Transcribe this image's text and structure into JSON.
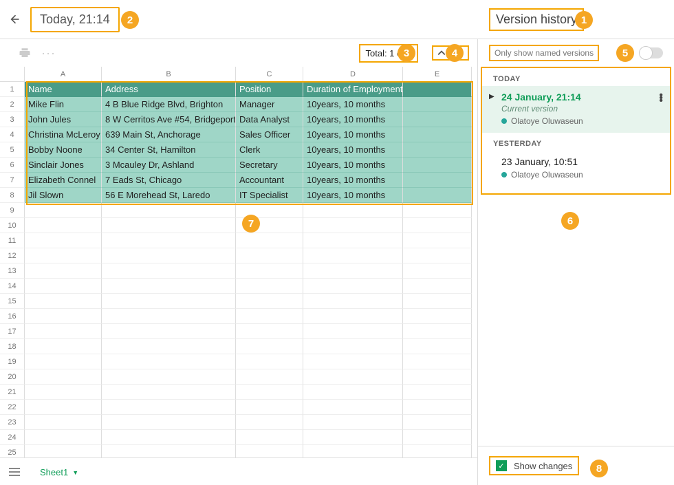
{
  "header": {
    "title": "Today, 21:14"
  },
  "toolbar": {
    "total": "Total: 1 edit"
  },
  "sidebar": {
    "title": "Version history",
    "only_named": "Only show named versions",
    "sections": [
      {
        "label": "TODAY",
        "items": [
          {
            "title": "24 January, 21:14",
            "sub": "Current version",
            "author": "Olatoye Oluwaseun",
            "selected": true
          }
        ]
      },
      {
        "label": "YESTERDAY",
        "items": [
          {
            "title": "23 January, 10:51",
            "author": "Olatoye Oluwaseun",
            "selected": false
          }
        ]
      }
    ],
    "show_changes": "Show changes"
  },
  "sheet": {
    "tab": "Sheet1"
  },
  "columns": [
    "A",
    "B",
    "C",
    "D",
    "E"
  ],
  "chart_data": {
    "type": "table",
    "headers": [
      "Name",
      "Address",
      "Position",
      "Duration of Employment"
    ],
    "rows": [
      [
        "Mike Flin",
        "4 B Blue Ridge Blvd, Brighton",
        "Manager",
        "10years, 10 months"
      ],
      [
        "John Jules",
        "8 W Cerritos Ave #54, Bridgeport",
        "Data Analyst",
        "10years, 10 months"
      ],
      [
        "Christina McLeroy",
        "639 Main St, Anchorage",
        "Sales Officer",
        "10years, 10 months"
      ],
      [
        "Bobby Noone",
        "34 Center St, Hamilton",
        "Clerk",
        "10years, 10 months"
      ],
      [
        "Sinclair Jones",
        "3 Mcauley Dr, Ashland",
        "Secretary",
        "10years, 10 months"
      ],
      [
        "Elizabeth Connel",
        "7 Eads St, Chicago",
        "Accountant",
        "10years, 10 months"
      ],
      [
        "Jil Slown",
        "56 E Morehead St, Laredo",
        "IT Specialist",
        "10years, 10 months"
      ]
    ]
  },
  "badges": [
    "1",
    "2",
    "3",
    "4",
    "5",
    "6",
    "7",
    "8"
  ]
}
